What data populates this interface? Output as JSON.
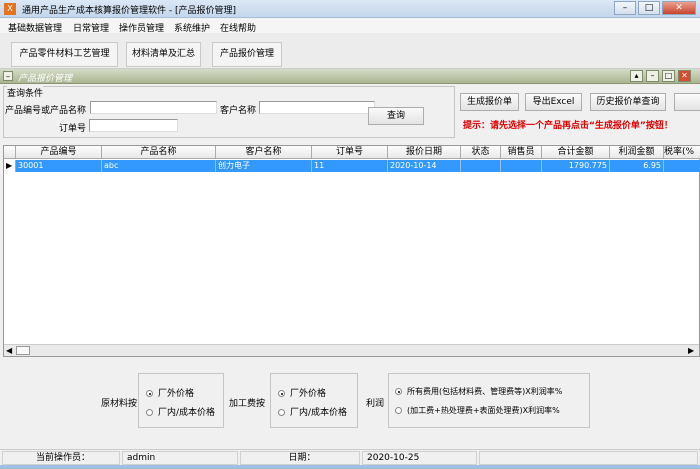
{
  "window": {
    "title": "通用产品生产成本核算报价管理软件  - [产品报价管理]",
    "app_icon": "app-icon",
    "controls": [
      "minimize",
      "maximize",
      "close"
    ]
  },
  "menu": [
    "基础数据管理",
    "日常管理",
    "操作员管理",
    "系统维护",
    "在线帮助"
  ],
  "toolbar": [
    "产品零件材料工艺管理",
    "材料清单及汇总",
    "产品报价管理"
  ],
  "child": {
    "title": "产品报价管理"
  },
  "query": {
    "group_title": "查询条件",
    "product_label": "产品编号或产品名称",
    "product_value": "",
    "customer_label": "客户名称",
    "customer_value": "",
    "order_label": "订单号",
    "order_value": "",
    "search_button": "查询"
  },
  "actions": {
    "generate": "生成报价单",
    "export": "导出Excel",
    "history": "历史报价单查询",
    "hint": "提示：请先选择一个产品再点击“生成报价单”按钮！"
  },
  "grid": {
    "columns": [
      "产品编号",
      "产品名称",
      "客户名称",
      "订单号",
      "报价日期",
      "状态",
      "销售员",
      "合计金额",
      "利润金额",
      "税率(%"
    ],
    "rows": [
      [
        "30001",
        "abc",
        "创力电子",
        "11",
        "2020-10-14",
        "",
        "",
        "1790.775",
        "6.95",
        ""
      ]
    ]
  },
  "options": {
    "material_label": "原材料按",
    "material": [
      "厂外价格",
      "厂内/成本价格"
    ],
    "material_selected": 0,
    "processing_label": "加工费按",
    "processing": [
      "厂外价格",
      "厂内/成本价格"
    ],
    "processing_selected": 0,
    "profit_label": "利润",
    "profit": [
      "所有费用(包括材料费、管理费等)X利润率%",
      "(加工费+热处理费+表面处理费)X利润率%"
    ],
    "profit_selected": 0
  },
  "status": {
    "operator_label": "当前操作员：",
    "operator": "admin",
    "date_label": "日期：",
    "date": "2020-10-25"
  },
  "colors": {
    "selection": "#3399ff",
    "hint": "#e00000",
    "child_title": "#aab592"
  }
}
